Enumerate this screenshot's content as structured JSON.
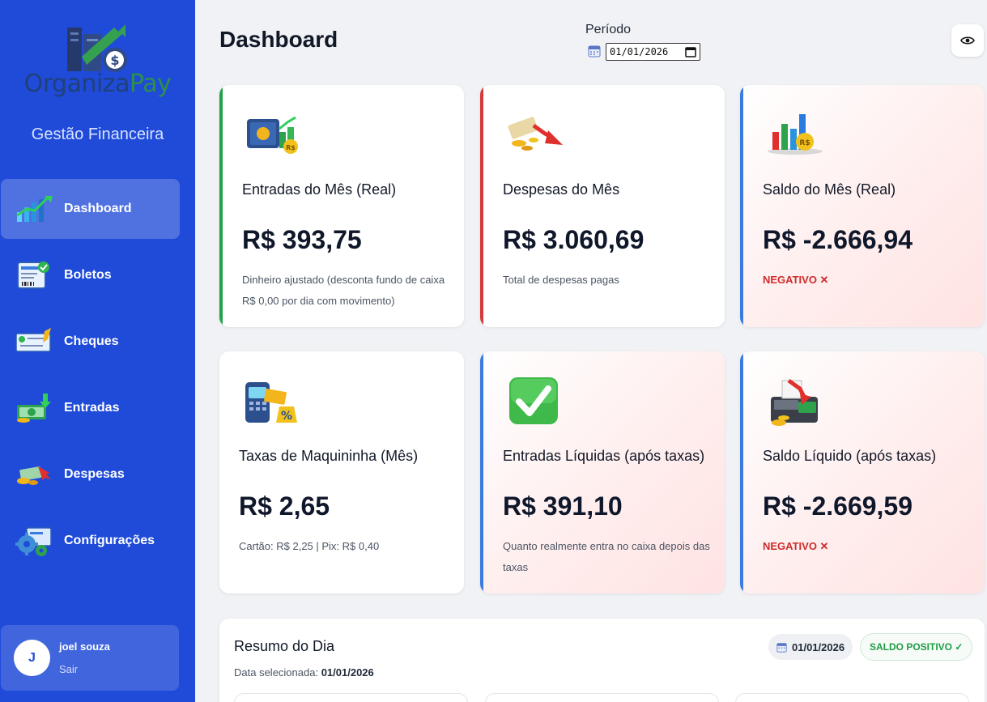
{
  "sidebar": {
    "brand_part1": "Organiza",
    "brand_part2": "Pay",
    "tagline": "Gestão Financeira",
    "items": [
      {
        "label": "Dashboard",
        "icon": "chart-growth-icon",
        "active": true
      },
      {
        "label": "Boletos",
        "icon": "invoice-icon",
        "active": false
      },
      {
        "label": "Cheques",
        "icon": "check-icon",
        "active": false
      },
      {
        "label": "Entradas",
        "icon": "money-in-icon",
        "active": false
      },
      {
        "label": "Despesas",
        "icon": "expenses-icon",
        "active": false
      },
      {
        "label": "Configurações",
        "icon": "gears-icon",
        "active": false
      }
    ],
    "user": {
      "initial": "J",
      "name": "joel souza",
      "logout": "Sair"
    }
  },
  "header": {
    "title": "Dashboard",
    "period_label": "Período",
    "period_value": "01/01/2026"
  },
  "cards": [
    {
      "title": "Entradas do Mês (Real)",
      "value": "R$ 393,75",
      "note": "Dinheiro ajustado (desconta fundo de caixa R$ 0,00 por dia com movimento)",
      "accent": "#22a04a",
      "tone": "white",
      "icon": "safe-money-icon"
    },
    {
      "title": "Despesas do Mês",
      "value": "R$ 3.060,69",
      "note": "Total de despesas pagas",
      "accent": "#d63a3a",
      "tone": "white",
      "icon": "money-down-icon"
    },
    {
      "title": "Saldo do Mês (Real)",
      "value": "R$ -2.666,94",
      "status": "NEGATIVO ✕",
      "accent": "#3b7be0",
      "tone": "pink",
      "icon": "bar-chart-coin-icon"
    },
    {
      "title": "Taxas de Maquininha (Mês)",
      "value": "R$ 2,65",
      "note": "Cartão: R$ 2,25 | Pix: R$ 0,40",
      "accent": "",
      "tone": "white",
      "icon": "card-machine-icon"
    },
    {
      "title": "Entradas Líquidas (após taxas)",
      "value": "R$ 391,10",
      "note": "Quanto realmente entra no caixa depois das taxas",
      "accent": "#3b7be0",
      "tone": "pink",
      "icon": "check-mark-icon"
    },
    {
      "title": "Saldo Líquido (após taxas)",
      "value": "R$ -2.669,59",
      "status": "NEGATIVO ✕",
      "accent": "#3b7be0",
      "tone": "pink",
      "icon": "cash-register-icon"
    }
  ],
  "resumo": {
    "title": "Resumo do Dia",
    "sub_label": "Data selecionada:",
    "sub_date": "01/01/2026",
    "date_pill": "01/01/2026",
    "status": "SALDO POSITIVO ✓"
  },
  "colors": {
    "sidebar": "#1f4bd8",
    "positive": "#1f9d47",
    "negative": "#d02b2b"
  }
}
